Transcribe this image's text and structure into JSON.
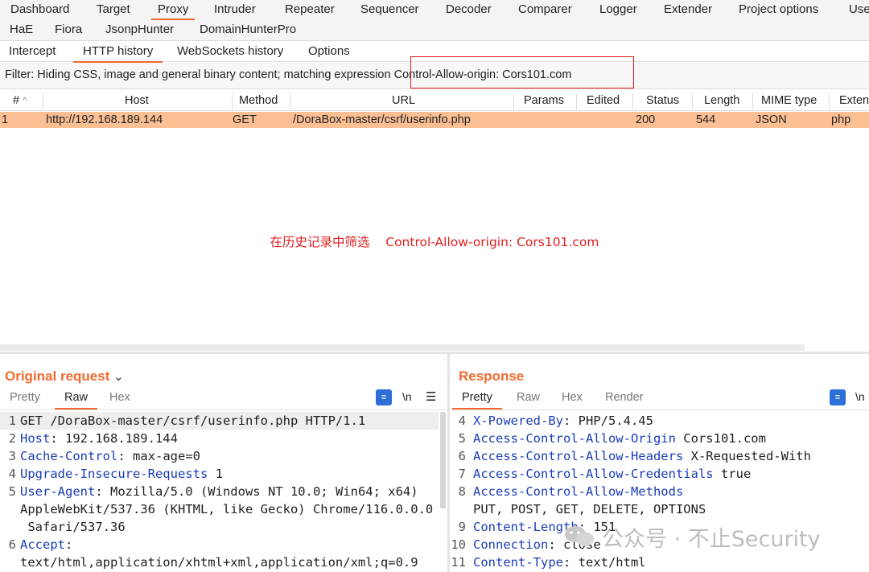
{
  "main_tabs": [
    "Dashboard",
    "Target",
    "Proxy",
    "Intruder",
    "Repeater",
    "Sequencer",
    "Decoder",
    "Comparer",
    "Logger",
    "Extender",
    "Project options",
    "Use"
  ],
  "ext_tabs": [
    "HaE",
    "Fiora",
    "JsonpHunter",
    "DomainHunterPro"
  ],
  "proxy_tabs": [
    "Intercept",
    "HTTP history",
    "WebSockets history",
    "Options"
  ],
  "filter": {
    "prefix": "Filter: Hiding CSS, image and general binary content;  matching expression ",
    "expression": "Control-Allow-origin: Cors101.com"
  },
  "table": {
    "columns": [
      "#",
      "Host",
      "Method",
      "URL",
      "Params",
      "Edited",
      "Status",
      "Length",
      "MIME type",
      "Exten"
    ],
    "sort_icon": "^",
    "rows": [
      {
        "num": "1",
        "host": "http://192.168.189.144",
        "method": "GET",
        "url": "/DoraBox-master/csrf/userinfo.php",
        "params": "",
        "edited": "",
        "status": "200",
        "length": "544",
        "mime": "JSON",
        "ext": "php"
      }
    ]
  },
  "annotation": "在历史记录中筛选    Control-Allow-origin: Cors101.com",
  "request": {
    "title": "Original request",
    "chevron": "⌄",
    "tabs": [
      "Pretty",
      "Raw",
      "Hex"
    ],
    "wrap_label": "\\n",
    "menu_glyph": "☰",
    "lines": [
      {
        "n": "1",
        "key": "",
        "text": "GET /DoraBox-master/csrf/userinfo.php HTTP/1.1"
      },
      {
        "n": "2",
        "key": "Host",
        "text": ": 192.168.189.144"
      },
      {
        "n": "3",
        "key": "Cache-Control",
        "text": ": max-age=0"
      },
      {
        "n": "4",
        "key": "Upgrade-Insecure-Requests",
        "text": " 1"
      },
      {
        "n": "5",
        "key": "User-Agent",
        "text": ": Mozilla/5.0 (Windows NT 10.0; Win64; x64)"
      },
      {
        "n": "",
        "key": "",
        "text": "AppleWebKit/537.36 (KHTML, like Gecko) Chrome/116.0.0.0"
      },
      {
        "n": "",
        "key": "",
        "text": " Safari/537.36"
      },
      {
        "n": "6",
        "key": "Accept",
        "text": ":"
      },
      {
        "n": "",
        "key": "",
        "text": "text/html,application/xhtml+xml,application/xml;q=0.9"
      }
    ]
  },
  "response": {
    "title": "Response",
    "tabs": [
      "Pretty",
      "Raw",
      "Hex",
      "Render"
    ],
    "wrap_label": "\\n",
    "lines": [
      {
        "n": "4",
        "key": "X-Powered-By",
        "text": ": PHP/5.4.45"
      },
      {
        "n": "5",
        "key": "Access-Control-Allow-Origin",
        "text": " Cors101.com"
      },
      {
        "n": "6",
        "key": "Access-Control-Allow-Headers",
        "text": " X-Requested-With"
      },
      {
        "n": "7",
        "key": "Access-Control-Allow-Credentials",
        "text": " true"
      },
      {
        "n": "8",
        "key": "Access-Control-Allow-Methods",
        "text": ""
      },
      {
        "n": "",
        "key": "",
        "text": "PUT, POST, GET, DELETE, OPTIONS"
      },
      {
        "n": "9",
        "key": "Content-Length",
        "text": ": 151"
      },
      {
        "n": "10",
        "key": "Connection",
        "text": ": close"
      },
      {
        "n": "11",
        "key": "Content-Type",
        "text": ": text/html"
      }
    ]
  },
  "watermark": "公众号 · 不止Security",
  "colors": {
    "accent": "#f26a2e",
    "selected_row": "#fbbf94",
    "header_key": "#1a3bb8",
    "annotation": "#e02020",
    "icon_blue": "#2c6fd6"
  }
}
